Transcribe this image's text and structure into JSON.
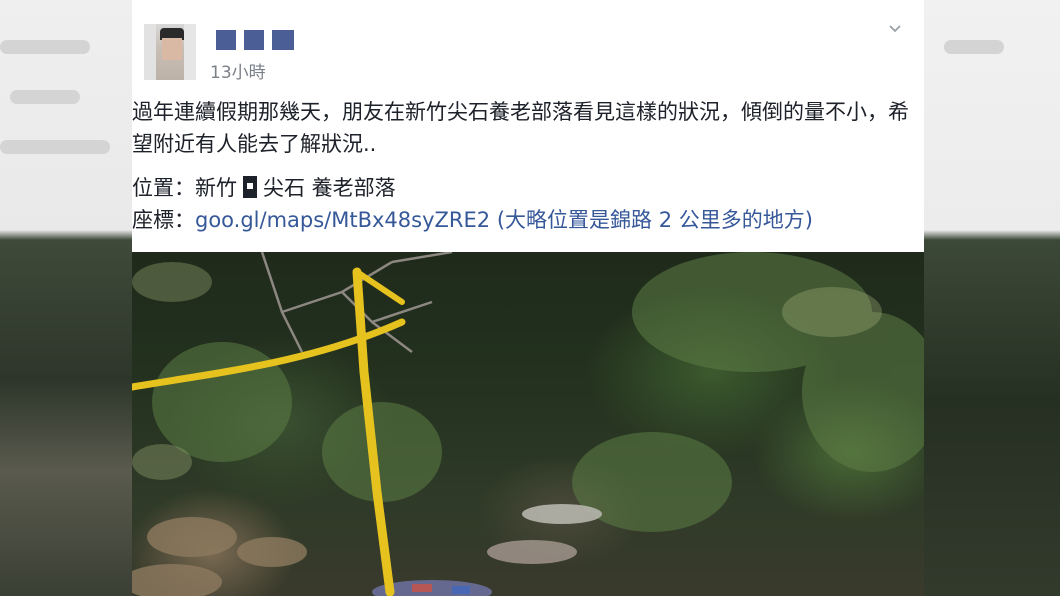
{
  "post": {
    "timestamp": "13小時",
    "text": "過年連續假期那幾天，朋友在新竹尖石養老部落看見這樣的狀況，傾倒的量不小，希望附近有人能去了解狀況..",
    "location_label": "位置：",
    "location_part1": "新竹",
    "location_part2": "尖石  養老部落",
    "coords_label": "座標：",
    "coords_link": "goo.gl/maps/MtBx48syZRE2",
    "coords_note": "(大略位置是錦路 2 公里多的地方)"
  },
  "icons": {
    "menu": "chevron-down-icon",
    "unknown_glyph": "missing-glyph-icon"
  },
  "colors": {
    "link": "#365899",
    "name_block": "#4b5e95",
    "tape": "#e6c21f"
  }
}
